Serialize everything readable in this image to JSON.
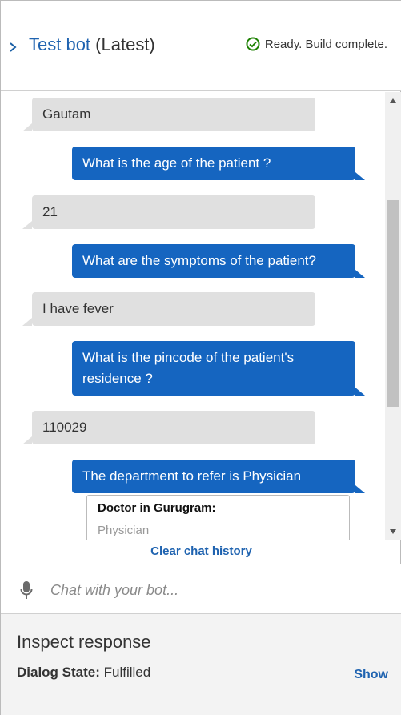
{
  "header": {
    "title_link": "Test bot",
    "title_suffix": "(Latest)",
    "status_text": "Ready. Build complete.",
    "status_icon": "check-circle-icon",
    "status_color": "#1d8102"
  },
  "messages": [
    {
      "from": "user",
      "text": "Gautam"
    },
    {
      "from": "bot",
      "text": "What is the age of the patient ?"
    },
    {
      "from": "user",
      "text": "21"
    },
    {
      "from": "bot",
      "text": "What are the symptoms of the patient?"
    },
    {
      "from": "user",
      "text": "I have fever"
    },
    {
      "from": "bot",
      "text": "What is the pincode of the patient's residence ?"
    },
    {
      "from": "user",
      "text": "110029"
    },
    {
      "from": "bot",
      "text": "The department to refer is Physician"
    }
  ],
  "card": {
    "title": "Doctor in Gurugram:",
    "subtitle": "Physician"
  },
  "clear_label": "Clear chat history",
  "input": {
    "placeholder": "Chat with your bot...",
    "value": ""
  },
  "inspect": {
    "title": "Inspect response",
    "dialog_label": "Dialog State:",
    "dialog_value": "Fulfilled",
    "show_label": "Show"
  },
  "colors": {
    "accent": "#1f63b0",
    "bot_bubble": "#1565c0",
    "user_bubble": "#e0e0e0"
  }
}
